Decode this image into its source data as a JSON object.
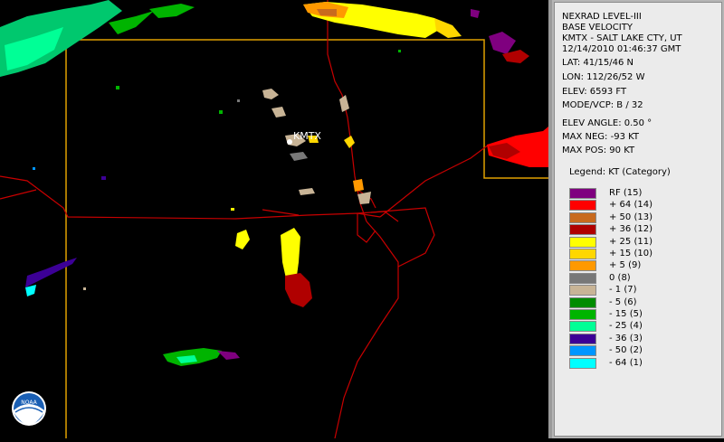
{
  "info": {
    "product": "NEXRAD LEVEL-III",
    "type": "BASE VELOCITY",
    "station": "KMTX - SALT LAKE CTY, UT",
    "datetime": "12/14/2010 01:46:37 GMT",
    "lat": "LAT: 41/15/46 N",
    "lon": "LON: 112/26/52 W",
    "elev": "ELEV: 6593 FT",
    "mode": "MODE/VCP: B / 32",
    "elev_angle": "ELEV ANGLE: 0.50 °",
    "max_neg": "MAX NEG: -93 KT",
    "max_pos": "MAX POS: 90 KT"
  },
  "legend": {
    "title": "Legend: KT (Category)",
    "items": [
      {
        "label": "RF  (15)",
        "color": "#7f007f"
      },
      {
        "label": "+ 64  (14)",
        "color": "#ff0000"
      },
      {
        "label": "+ 50  (13)",
        "color": "#c86a1e"
      },
      {
        "label": "+ 36  (12)",
        "color": "#b00000"
      },
      {
        "label": "+ 25  (11)",
        "color": "#ffff00"
      },
      {
        "label": "+ 15  (10)",
        "color": "#ffd700"
      },
      {
        "label": "+ 5  (9)",
        "color": "#ff9900"
      },
      {
        "label": "0  (8)",
        "color": "#787878"
      },
      {
        "label": "- 1  (7)",
        "color": "#c8b496"
      },
      {
        "label": "- 5  (6)",
        "color": "#008c00"
      },
      {
        "label": "- 15  (5)",
        "color": "#00b400"
      },
      {
        "label": "- 25  (4)",
        "color": "#00ff96"
      },
      {
        "label": "- 36  (3)",
        "color": "#3c0096"
      },
      {
        "label": "- 50  (2)",
        "color": "#0096ff"
      },
      {
        "label": "- 64  (1)",
        "color": "#00ffff"
      }
    ]
  },
  "map": {
    "radar_label": "KMTX",
    "logo_text": "NOAA",
    "colors": {
      "border": "#e0a000",
      "road": "#c80000"
    }
  }
}
